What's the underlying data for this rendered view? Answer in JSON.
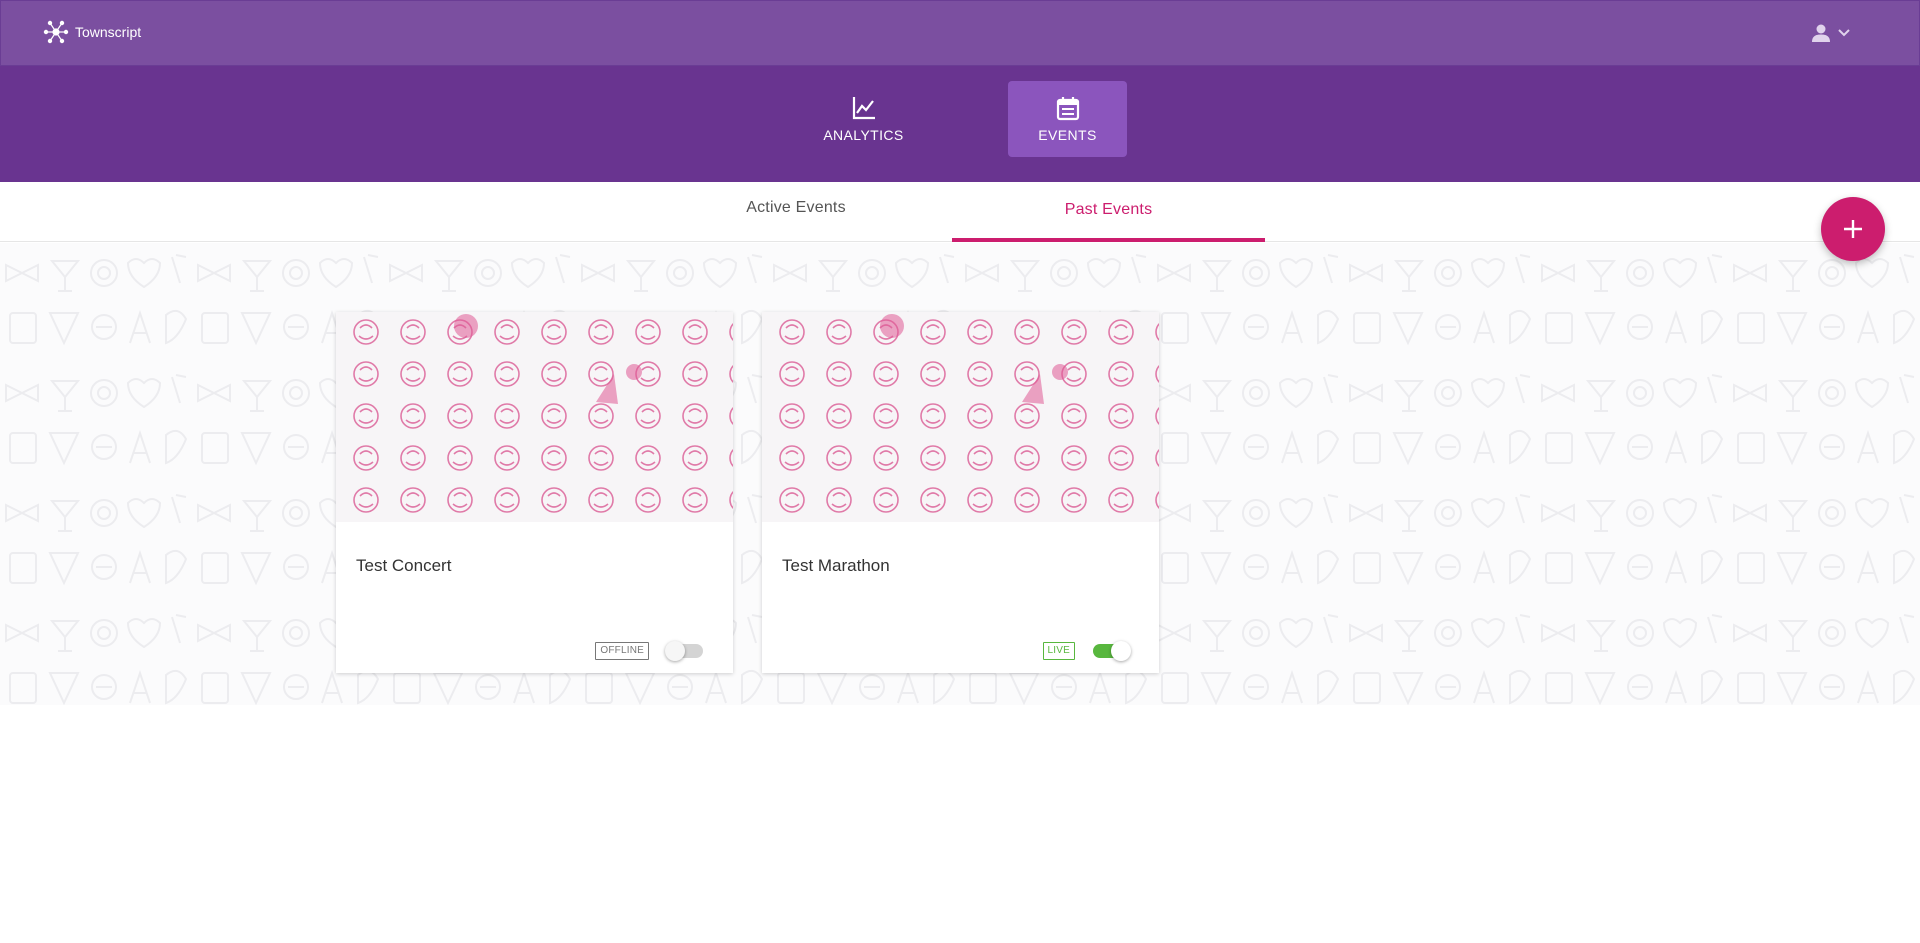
{
  "app": {
    "brand": "Townscript"
  },
  "colors": {
    "topbar": "#7b4fa0",
    "navbar": "#693490",
    "nav_active": "#8b55bd",
    "accent": "#cc1d6e",
    "live": "#58b73e"
  },
  "header": {
    "user_icon": "user-icon",
    "menu_icon": "chevron-down-icon"
  },
  "nav": {
    "tabs": [
      {
        "label": "ANALYTICS",
        "icon": "line-chart-icon",
        "active": false
      },
      {
        "label": "EVENTS",
        "icon": "calendar-icon",
        "active": true
      }
    ]
  },
  "subtabs": [
    {
      "label": "Active Events",
      "active": false
    },
    {
      "label": "Past Events",
      "active": true
    }
  ],
  "fab": {
    "icon": "plus-icon"
  },
  "events": [
    {
      "title": "Test Concert",
      "status": "OFFLINE",
      "enabled": false
    },
    {
      "title": "Test Marathon",
      "status": "LIVE",
      "enabled": true
    }
  ]
}
